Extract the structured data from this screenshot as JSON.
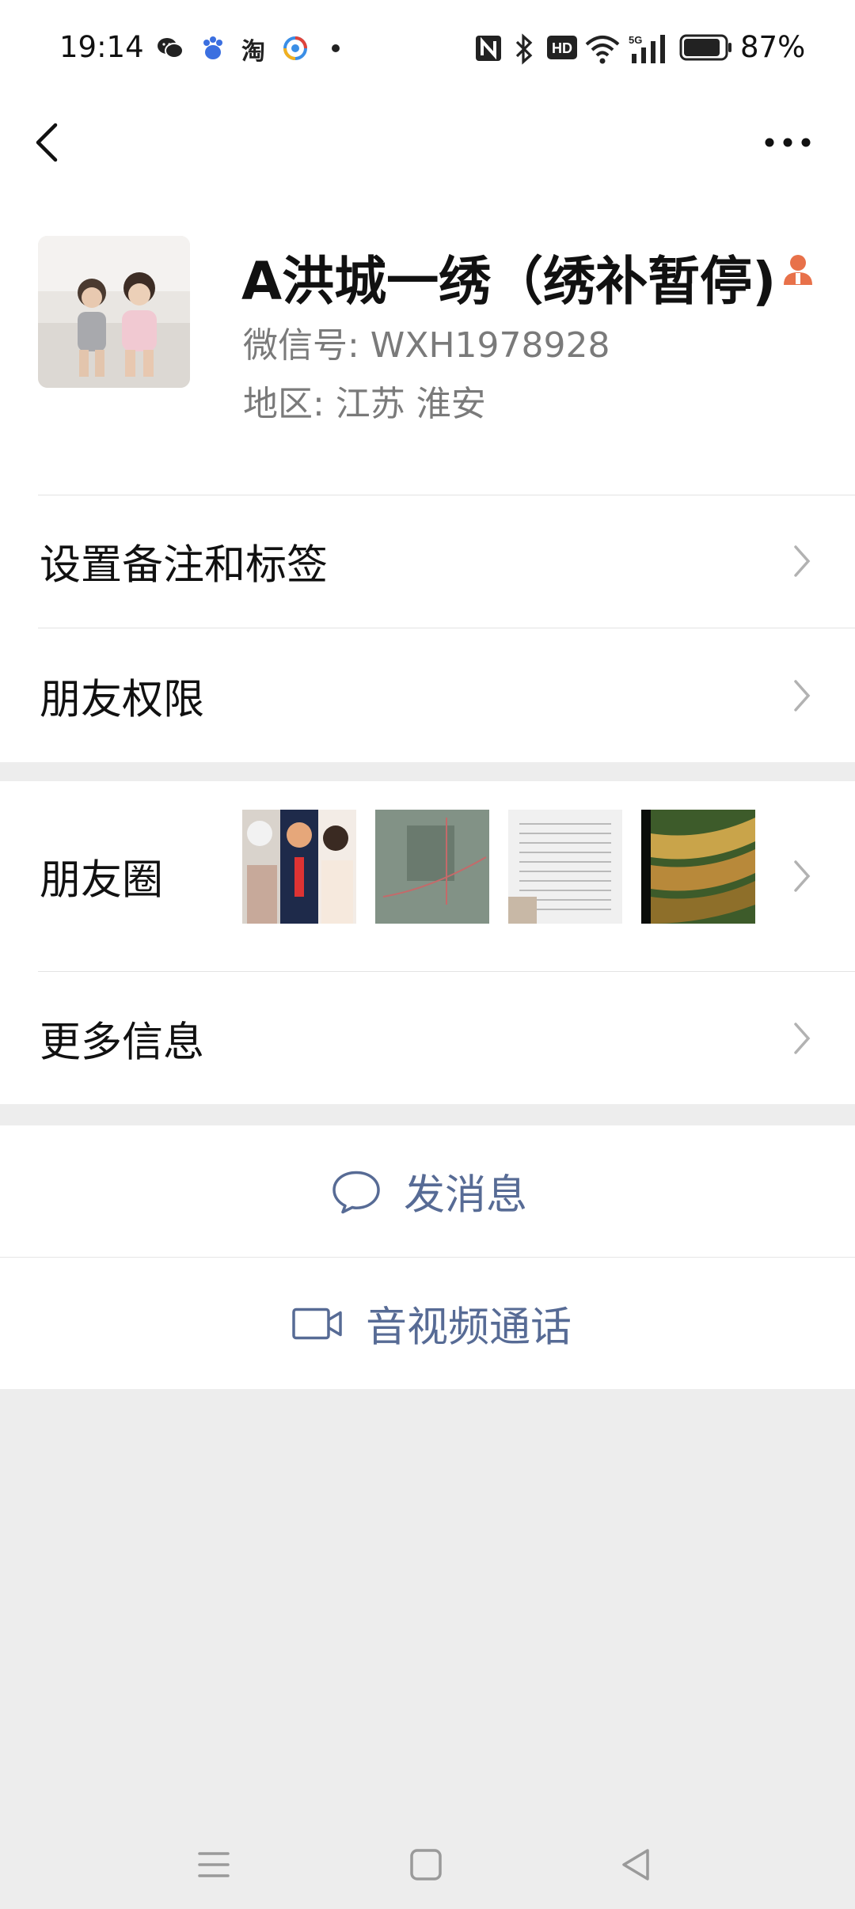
{
  "status_bar": {
    "time": "19:14",
    "app_icons": [
      "wechat-icon",
      "baidu-icon",
      "taobao-icon",
      "browser-icon",
      "dot-icon"
    ],
    "taobao_char": "淘",
    "right_icons": [
      "nfc-icon",
      "bluetooth-icon",
      "hd-icon",
      "wifi-icon",
      "signal-5g-icon",
      "battery-icon"
    ],
    "hd_label": "HD",
    "network_label": "5G",
    "battery": "87%"
  },
  "nav": {
    "back": "back-icon",
    "more": "more-icon"
  },
  "profile": {
    "name": "A洪城一绣（绣补暂停)",
    "wechat_id_line": "微信号:  WXH1978928",
    "region_line": "地区:  江苏  淮安"
  },
  "rows": {
    "remark_tags": "设置备注和标签",
    "friend_permissions": "朋友权限",
    "moments": "朋友圈",
    "more_info": "更多信息"
  },
  "actions": {
    "send_message": "发消息",
    "video_call": "音视频通话"
  },
  "colors": {
    "link": "#576b95",
    "badge": "#e8714a",
    "background": "#ededed"
  }
}
